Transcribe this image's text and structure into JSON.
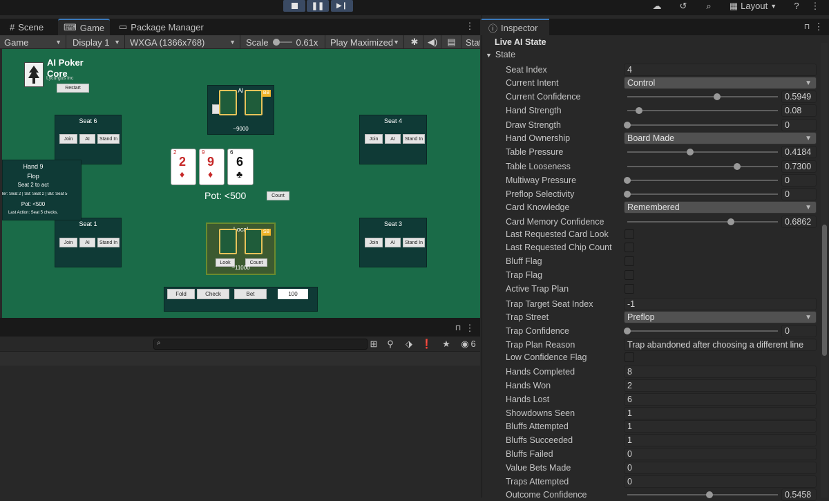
{
  "toolbar": {
    "layout_label": "Layout"
  },
  "tabs": {
    "scene": "Scene",
    "game": "Game",
    "package_manager": "Package Manager",
    "inspector": "Inspector"
  },
  "game_toolbar": {
    "view": "Game",
    "display": "Display 1",
    "resolution": "WXGA (1366x768)",
    "scale_label": "Scale",
    "scale_value": "0.61x",
    "play_mode": "Play Maximized",
    "stats": "Stat"
  },
  "game": {
    "title_line1": "AI Poker",
    "title_line2": "Core",
    "company": "Lycurgus Inc",
    "restart": "Restart",
    "seat6": "Seat 6",
    "seat4": "Seat 4",
    "seat1": "Seat 1",
    "seat3": "Seat 3",
    "join": "Join",
    "ai": "AI",
    "stand": "Stand In",
    "ai_seat_label": "AI",
    "ai_seat_chips": "~9000",
    "bb_badge": "BB",
    "sb_badge": "SB",
    "local_seat_label": "Local",
    "local_seat_chips": "~11000",
    "look": "Look",
    "count": "Count",
    "hand": "Hand 9",
    "street": "Flop",
    "to_act": "Seat 2 to act",
    "dealer_line": "ler: Seat 2 | SB: Seat 2 | BB: Seat 5",
    "pot_small": "Pot: <500",
    "last_action": "Last Action: Seat 5 checks.",
    "pot": "Pot: <500",
    "pot_count": "Count",
    "cards": [
      {
        "rank": "2",
        "suit": "♦",
        "color": "#c62828"
      },
      {
        "rank": "9",
        "suit": "♦",
        "color": "#c62828"
      },
      {
        "rank": "6",
        "suit": "♣",
        "color": "#111111"
      }
    ],
    "fold": "Fold",
    "check": "Check",
    "bet": "Bet",
    "bet_amount": "100"
  },
  "console": {
    "count": "6"
  },
  "inspector": {
    "component": "Live AI State",
    "group": "State",
    "rows": {
      "seat_index": {
        "label": "Seat Index",
        "value": "4"
      },
      "current_intent": {
        "label": "Current Intent",
        "value": "Control"
      },
      "current_confidence": {
        "label": "Current Confidence",
        "value": "0.5949",
        "level": 0.5949
      },
      "hand_strength": {
        "label": "Hand Strength",
        "value": "0.08",
        "level": 0.08
      },
      "draw_strength": {
        "label": "Draw Strength",
        "value": "0",
        "level": 0
      },
      "hand_ownership": {
        "label": "Hand Ownership",
        "value": "Board Made"
      },
      "table_pressure": {
        "label": "Table Pressure",
        "value": "0.4184",
        "level": 0.4184
      },
      "table_looseness": {
        "label": "Table Looseness",
        "value": "0.7300",
        "level": 0.73
      },
      "multiway_pressure": {
        "label": "Multiway Pressure",
        "value": "0",
        "level": 0
      },
      "preflop_selectivity": {
        "label": "Preflop Selectivity",
        "value": "0",
        "level": 0
      },
      "card_knowledge": {
        "label": "Card Knowledge",
        "value": "Remembered"
      },
      "card_memory_confidence": {
        "label": "Card Memory Confidence",
        "value": "0.6862",
        "level": 0.6862
      },
      "last_req_card_look": {
        "label": "Last Requested Card Look"
      },
      "last_req_chip_count": {
        "label": "Last Requested Chip Count"
      },
      "bluff_flag": {
        "label": "Bluff Flag"
      },
      "trap_flag": {
        "label": "Trap Flag"
      },
      "active_trap_plan": {
        "label": "Active Trap Plan"
      },
      "trap_target_seat_index": {
        "label": "Trap Target Seat Index",
        "value": "-1"
      },
      "trap_street": {
        "label": "Trap Street",
        "value": "Preflop"
      },
      "trap_confidence": {
        "label": "Trap Confidence",
        "value": "0",
        "level": 0
      },
      "trap_plan_reason": {
        "label": "Trap Plan Reason",
        "value": "Trap abandoned after choosing a different line"
      },
      "low_confidence_flag": {
        "label": "Low Confidence Flag"
      },
      "hands_completed": {
        "label": "Hands Completed",
        "value": "8"
      },
      "hands_won": {
        "label": "Hands Won",
        "value": "2"
      },
      "hands_lost": {
        "label": "Hands Lost",
        "value": "6"
      },
      "showdowns_seen": {
        "label": "Showdowns Seen",
        "value": "1"
      },
      "bluffs_attempted": {
        "label": "Bluffs Attempted",
        "value": "1"
      },
      "bluffs_succeeded": {
        "label": "Bluffs Succeeded",
        "value": "1"
      },
      "bluffs_failed": {
        "label": "Bluffs Failed",
        "value": "0"
      },
      "value_bets_made": {
        "label": "Value Bets Made",
        "value": "0"
      },
      "traps_attempted": {
        "label": "Traps Attempted",
        "value": "0"
      },
      "outcome_confidence": {
        "label": "Outcome Confidence",
        "value": "0.5458",
        "level": 0.5458
      }
    }
  }
}
